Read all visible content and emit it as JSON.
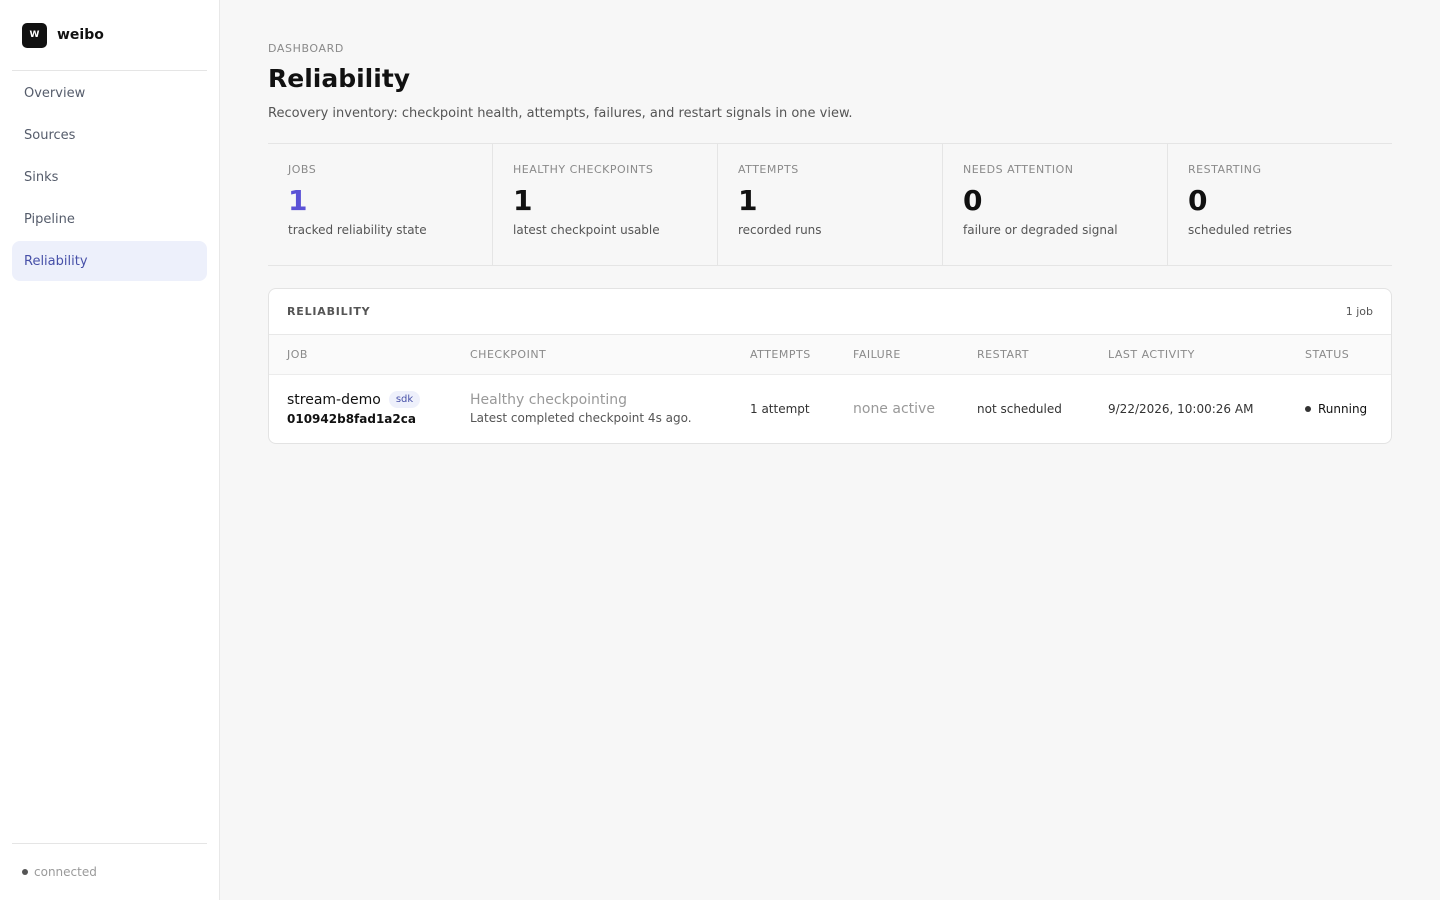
{
  "brand": {
    "logo_glyph": "W",
    "name": "weibo"
  },
  "nav": {
    "items": [
      {
        "label": "Overview"
      },
      {
        "label": "Sources"
      },
      {
        "label": "Sinks"
      },
      {
        "label": "Pipeline"
      },
      {
        "label": "Reliability"
      }
    ],
    "active": "Reliability"
  },
  "footer": {
    "status": "connected"
  },
  "header": {
    "eyebrow": "DASHBOARD",
    "title": "Reliability",
    "subtitle": "Recovery inventory: checkpoint health, attempts, failures, and restart signals in one view."
  },
  "stats": [
    {
      "label": "JOBS",
      "value": "1",
      "desc": "tracked reliability state"
    },
    {
      "label": "HEALTHY CHECKPOINTS",
      "value": "1",
      "desc": "latest checkpoint usable"
    },
    {
      "label": "ATTEMPTS",
      "value": "1",
      "desc": "recorded runs"
    },
    {
      "label": "NEEDS ATTENTION",
      "value": "0",
      "desc": "failure or degraded signal"
    },
    {
      "label": "RESTARTING",
      "value": "0",
      "desc": "scheduled retries"
    }
  ],
  "table": {
    "title": "RELIABILITY",
    "count": "1 job",
    "columns": [
      "JOB",
      "CHECKPOINT",
      "ATTEMPTS",
      "FAILURE",
      "RESTART",
      "LAST ACTIVITY",
      "STATUS"
    ],
    "rows": [
      {
        "job_name": "stream-demo",
        "job_badge": "sdk",
        "job_id": "010942b8fad1a2ca",
        "checkpoint_title": "Healthy checkpointing",
        "checkpoint_sub": "Latest completed checkpoint 4s ago.",
        "attempts": "1 attempt",
        "failure": "none active",
        "restart": "not scheduled",
        "last_activity": "9/22/2026, 10:00:26 AM",
        "status": "Running"
      }
    ]
  },
  "colors": {
    "accent": "#5b52d6",
    "nav_active_bg": "#edf0fb",
    "nav_active_text": "#4750a8"
  }
}
